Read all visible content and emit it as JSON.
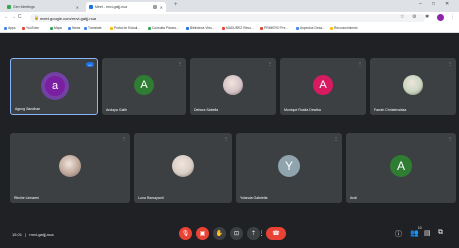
{
  "browser": {
    "tabs": [
      {
        "label": "Gen Meetings",
        "favicon_color": "#34a853",
        "active": false
      },
      {
        "label": "Meet - rmvi-gatjj-nua",
        "favicon_color": "#1a73e8",
        "active": true
      },
      {
        "label": "",
        "favicon_color": "#9aa0a6",
        "active": false
      }
    ],
    "new_tab": "+",
    "url": "meet.google.com/rmvi-gatjj-nua",
    "nav": {
      "back": "←",
      "forward": "→",
      "reload": "C",
      "home": "⌂"
    },
    "window": {
      "minimize": "–",
      "maximize": "□",
      "close": "✕"
    },
    "toolbar": {
      "star": "☆",
      "extensions": "⚙",
      "menu": "⋮"
    },
    "bookmarks": [
      {
        "label": "Apps",
        "color": "#4285f4"
      },
      {
        "label": "YouTube",
        "color": "#ea4335"
      },
      {
        "label": "Maps",
        "color": "#34a853"
      },
      {
        "label": "News",
        "color": "#4285f4"
      },
      {
        "label": "Translate",
        "color": "#4285f4"
      },
      {
        "label": "Portal de Estudi...",
        "color": "#fbbc05"
      },
      {
        "label": "Consulta Planos...",
        "color": "#34a853"
      },
      {
        "label": "Biblioteca Virtu...",
        "color": "#1a73e8"
      },
      {
        "label": "MADUREZ Reso...",
        "color": "#ea4335"
      },
      {
        "label": "PRIMERO Pre...",
        "color": "#ea4335"
      },
      {
        "label": "Aspectos Desa...",
        "color": "#4285f4"
      },
      {
        "label": "Reconocimiento",
        "color": "#fbbc05"
      }
    ]
  },
  "participants": [
    {
      "name": "Agung Sandhan",
      "initial": "a",
      "kind": "letter",
      "color": "#7b1fa2",
      "ring": "#a142f4",
      "active": true,
      "badge": "•••"
    },
    {
      "name": "Andaya Galih",
      "initial": "A",
      "kind": "letter",
      "color": "#2e7d32",
      "active": false
    },
    {
      "name": "Debora Sabella",
      "initial": "",
      "kind": "photo",
      "color": "#d4c3c8",
      "active": false
    },
    {
      "name": "Monique Rusita Dewika",
      "initial": "A",
      "kind": "letter",
      "color": "#d81b60",
      "active": false
    },
    {
      "name": "Farrah Christensiska",
      "initial": "",
      "kind": "photo",
      "color": "#c8d6c0",
      "active": false
    },
    {
      "name": "Ritchie Linnaeni",
      "initial": "",
      "kind": "photo",
      "color": "#bfa89a",
      "active": false
    },
    {
      "name": "Luna Ramayanti",
      "initial": "",
      "kind": "photo",
      "color": "#d9cec5",
      "active": false
    },
    {
      "name": "Yolanda Gabriella",
      "initial": "Y",
      "kind": "letter",
      "color": "#90a4ae",
      "active": false
    },
    {
      "name": "Andi",
      "initial": "A",
      "kind": "letter",
      "color": "#2e7d32",
      "active": false
    }
  ],
  "more_icon": "⋮",
  "footer": {
    "time": "15.01",
    "separator": "|",
    "meeting_code": "rmvi-gatjj-nua"
  },
  "controls": [
    {
      "name": "mic-off-button",
      "glyph": "🎙",
      "style": "red"
    },
    {
      "name": "camera-off-button",
      "glyph": "▣",
      "style": "red"
    },
    {
      "name": "raise-hand-button",
      "glyph": "✋",
      "style": "grey"
    },
    {
      "name": "captions-button",
      "glyph": "⊡",
      "style": "grey"
    },
    {
      "name": "present-button",
      "glyph": "⇡",
      "style": "grey"
    },
    {
      "name": "more-options-button",
      "glyph": "⋮",
      "style": "grey"
    },
    {
      "name": "leave-call-button",
      "glyph": "☎",
      "style": "pill-end"
    }
  ],
  "right_icons": [
    {
      "name": "info-icon",
      "glyph": "ⓘ",
      "badge": ""
    },
    {
      "name": "people-icon",
      "glyph": "👥",
      "badge": "10"
    },
    {
      "name": "chat-icon",
      "glyph": "▤",
      "badge": ""
    },
    {
      "name": "activities-icon",
      "glyph": "⧉",
      "badge": ""
    }
  ]
}
